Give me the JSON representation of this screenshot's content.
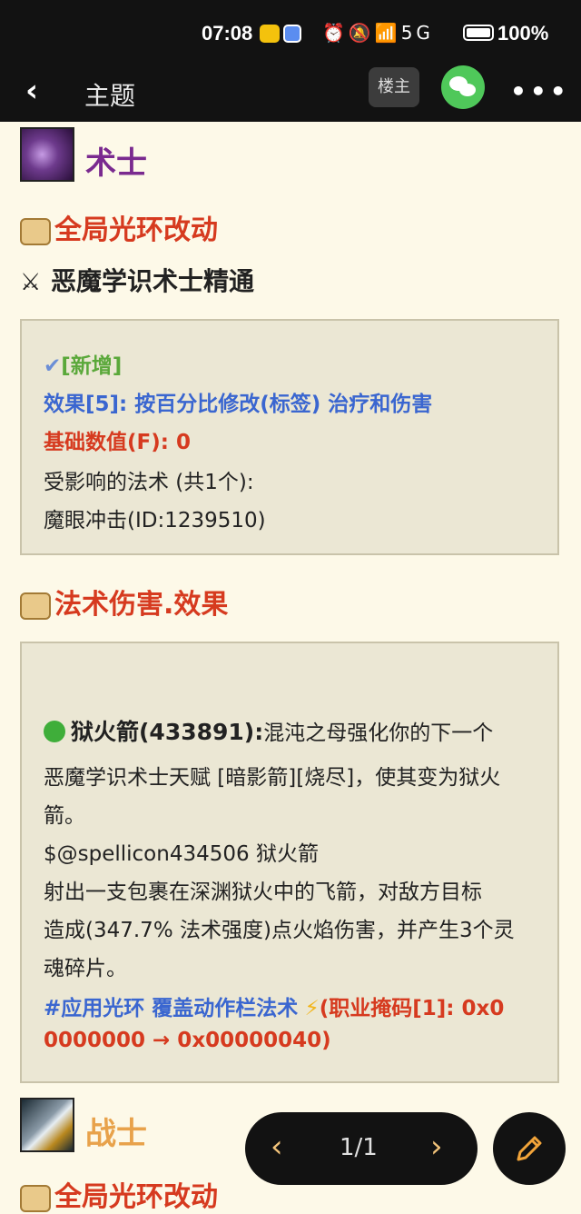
{
  "status_bar": {
    "time": "07:08",
    "icons": "⏰🔕📶5G",
    "battery": "100%"
  },
  "nav": {
    "back": "‹",
    "title": "主题",
    "louzhu": "楼主",
    "more": "•••"
  },
  "warlock": {
    "name": "术士",
    "section1": "全局光环改动",
    "sub1": "恶魔学识术士精通",
    "box1": {
      "new_tag": "[新增]",
      "effect": "效果[5]: 按百分比修改(标签) 治疗和伤害",
      "base_value": "基础数值(F): 0",
      "affected": "受影响的法术 (共1个):",
      "spell": "魔眼冲击(ID:1239510)"
    },
    "section2": "法术伤害.效果",
    "box2": {
      "title": "狱火箭(433891):",
      "l1": "混沌之母强化你的下一个",
      "l2": "恶魔学识术士天赋 [暗影箭][烧尽]，使其变为狱火",
      "l3": "箭。",
      "l4": "$@spellicon434506 狱火箭",
      "l5": "射出一支包裹在深渊狱火中的飞箭，对敌方目标",
      "l6": "造成(347.7% 法术强度)点火焰伤害，并产生3个灵",
      "l7": "魂碎片。",
      "aura": "#应用光环 覆盖动作栏法术",
      "mask1": "(职业掩码[1]: 0x0",
      "mask2": "0000000 → 0x00000040)"
    }
  },
  "warrior": {
    "name": "战士",
    "section1": "全局光环改动"
  },
  "pager": {
    "prev": "‹",
    "page": "1/1",
    "next": "›"
  },
  "colors": {
    "warlock": "#7a2a8f",
    "warrior": "#e8a24b",
    "heading_red": "#d63a1f",
    "link_blue": "#3a66d0",
    "green": "#5aa83a"
  }
}
